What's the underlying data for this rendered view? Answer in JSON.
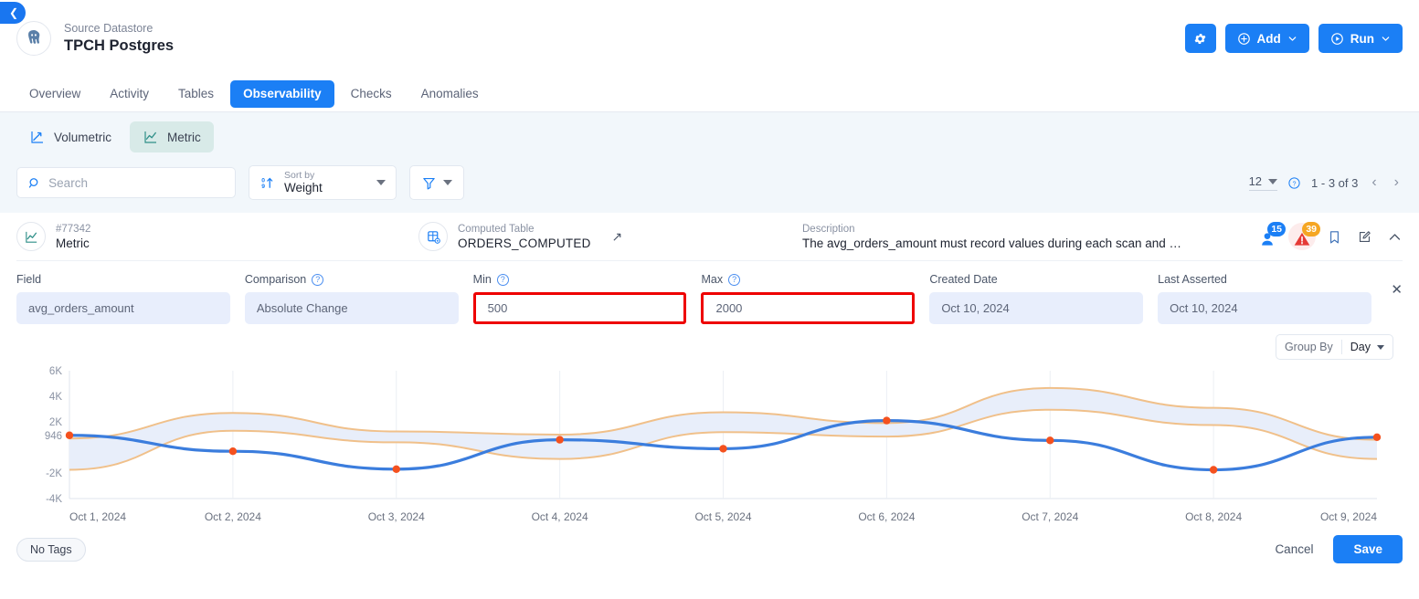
{
  "back_button": {
    "icon": "chevron-left-icon"
  },
  "header": {
    "kicker": "Source Datastore",
    "title": "TPCH Postgres",
    "avatar_icon": "postgres-elephant-logo",
    "actions": {
      "settings_icon": "gear-icon",
      "add_label": "Add",
      "add_icon": "plus-circle-icon",
      "run_label": "Run",
      "run_icon": "play-circle-icon",
      "chevron_icon": "chevron-down-icon"
    }
  },
  "tabs": [
    {
      "label": "Overview",
      "active": false
    },
    {
      "label": "Activity",
      "active": false
    },
    {
      "label": "Tables",
      "active": false
    },
    {
      "label": "Observability",
      "active": true
    },
    {
      "label": "Checks",
      "active": false
    },
    {
      "label": "Anomalies",
      "active": false
    }
  ],
  "segments": [
    {
      "label": "Volumetric",
      "icon": "volumetric-chart-icon",
      "active": false
    },
    {
      "label": "Metric",
      "icon": "metric-chart-icon",
      "active": true
    }
  ],
  "search": {
    "placeholder": "Search",
    "value": "",
    "icon": "search-icon"
  },
  "sort": {
    "label": "Sort by",
    "value": "Weight",
    "icon": "sort-numeric-icon"
  },
  "filter": {
    "icon": "funnel-icon"
  },
  "pagination": {
    "page_size": "12",
    "help_icon": "help-circle-icon",
    "range": "1 - 3 of 3",
    "prev_icon": "chevron-left-icon",
    "next_icon": "chevron-right-icon"
  },
  "card": {
    "type_id": "#77342",
    "type_label": "Metric",
    "type_icon": "metric-chart-icon",
    "table_label": "Computed Table",
    "table_value": "ORDERS_COMPUTED",
    "table_icon": "computed-table-icon",
    "external_link_icon": "external-link-icon",
    "description_label": "Description",
    "description_value": "The avg_orders_amount must record values during each scan and …",
    "badges": {
      "profile_count": "15",
      "profile_icon": "profile-icon",
      "profile_color": "#1b7ff5",
      "alert_count": "39",
      "alert_icon": "warning-triangle-icon",
      "alert_color": "#f5a623",
      "bookmark_icon": "bookmark-icon",
      "edit_icon": "edit-icon",
      "collapse_icon": "chevron-up-icon"
    },
    "fields": [
      {
        "label": "Field",
        "value": "avg_orders_amount",
        "help": false,
        "highlighted": false
      },
      {
        "label": "Comparison",
        "value": "Absolute Change",
        "help": true,
        "highlighted": false
      },
      {
        "label": "Min",
        "value": "500",
        "help": true,
        "highlighted": true
      },
      {
        "label": "Max",
        "value": "2000",
        "help": true,
        "highlighted": true
      },
      {
        "label": "Created Date",
        "value": "Oct 10, 2024",
        "help": false,
        "highlighted": false
      },
      {
        "label": "Last Asserted",
        "value": "Oct 10, 2024",
        "help": false,
        "highlighted": false
      }
    ],
    "close_icon": "close-icon",
    "group_by": {
      "label": "Group By",
      "value": "Day",
      "chevron_icon": "chevron-down-icon"
    },
    "tags": "No Tags",
    "cancel_label": "Cancel",
    "save_label": "Save"
  },
  "colors": {
    "accent": "#1b7ff5",
    "line": "#3b7ddd",
    "point": "#f4511e",
    "band_stroke": "#f0c08a",
    "band_fill": "#e8eefa",
    "highlight": "#ee0000"
  },
  "chart_data": {
    "type": "line",
    "title": "",
    "xlabel": "",
    "ylabel": "",
    "grid": true,
    "legend": "none",
    "ylim": [
      -4000,
      6000
    ],
    "yticks": [
      6000,
      4000,
      2000,
      946,
      -2000,
      -4000
    ],
    "ytick_labels": [
      "6K",
      "4K",
      "2K",
      "946",
      "-2K",
      "-4K"
    ],
    "categories": [
      "Oct 1, 2024",
      "Oct 2, 2024",
      "Oct 3, 2024",
      "Oct 4, 2024",
      "Oct 5, 2024",
      "Oct 6, 2024",
      "Oct 7, 2024",
      "Oct 8, 2024",
      "Oct 9, 2024"
    ],
    "series": [
      {
        "name": "metric",
        "values": [
          946,
          -300,
          -1700,
          600,
          -100,
          2100,
          550,
          -1750,
          800
        ]
      },
      {
        "name": "upper_bound",
        "values": [
          700,
          2700,
          1250,
          1000,
          2750,
          1900,
          4650,
          3100,
          600
        ]
      },
      {
        "name": "lower_bound",
        "values": [
          -1750,
          1300,
          400,
          -900,
          1200,
          850,
          2950,
          1750,
          -900
        ]
      }
    ]
  }
}
